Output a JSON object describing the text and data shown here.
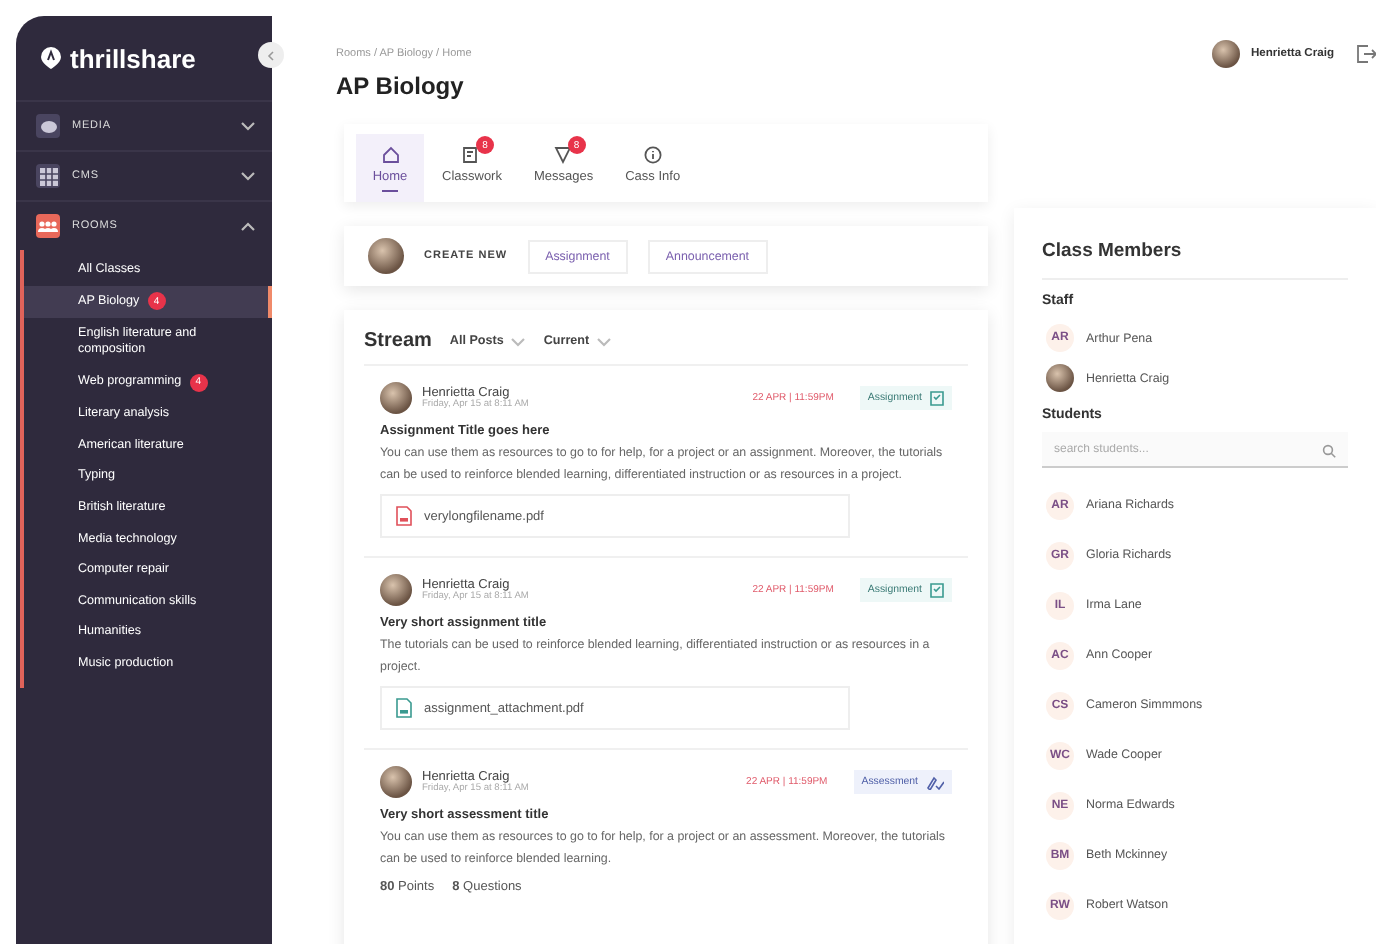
{
  "sidebar": {
    "logo": "thrillshare",
    "sections": [
      {
        "label": "MEDIA",
        "kind": "media",
        "expanded": false
      },
      {
        "label": "CMS",
        "kind": "cms",
        "expanded": false
      },
      {
        "label": "ROOMS",
        "kind": "rooms",
        "expanded": true,
        "items": [
          {
            "label": "All Classes",
            "selected": false
          },
          {
            "label": "AP Biology",
            "selected": true,
            "badge": "4"
          },
          {
            "label": "English literature and composition",
            "selected": false
          },
          {
            "label": "Web programming",
            "selected": false,
            "badge": "4"
          },
          {
            "label": "Literary analysis",
            "selected": false
          },
          {
            "label": "American literature",
            "selected": false
          },
          {
            "label": "Typing",
            "selected": false
          },
          {
            "label": "British literature",
            "selected": false
          },
          {
            "label": "Media technology",
            "selected": false
          },
          {
            "label": "Computer repair",
            "selected": false
          },
          {
            "label": "Communication skills",
            "selected": false
          },
          {
            "label": "Humanities",
            "selected": false
          },
          {
            "label": "Music production",
            "selected": false
          }
        ]
      }
    ]
  },
  "breadcrumb": "Rooms / AP Biology / Home",
  "user": {
    "name": "Henrietta Craig"
  },
  "title": "AP Biology",
  "tabs": [
    {
      "label": "Home",
      "kind": "home",
      "selected": true
    },
    {
      "label": "Classwork",
      "kind": "classwork",
      "selected": false,
      "badge": "8"
    },
    {
      "label": "Messages",
      "kind": "messages",
      "selected": false,
      "badge": "8"
    },
    {
      "label": "Cass Info",
      "kind": "info",
      "selected": false
    }
  ],
  "create_new": {
    "label": "CREATE NEW",
    "buttons": [
      "Assignment",
      "Announcement"
    ]
  },
  "stream": {
    "title": "Stream",
    "filters": [
      "All Posts",
      "Current"
    ],
    "posts": [
      {
        "author": "Henrietta Craig",
        "date": "Friday, Apr 15 at 8:11 AM",
        "due": "22 APR | 11:59PM",
        "tag": "Assignment",
        "kind": "assignment",
        "title": "Assignment Title goes here",
        "body": "You can use them as resources to go to for help, for a project or an assignment. Moreover, the tutorials can be used to reinforce blended learning, differentiated instruction or as resources in a project.",
        "attachment": {
          "name": "verylongfilename.pdf",
          "kind": "pdf"
        }
      },
      {
        "author": "Henrietta Craig",
        "date": "Friday, Apr 15 at 8:11 AM",
        "due": "22 APR | 11:59PM",
        "tag": "Assignment",
        "kind": "assignment",
        "title": "Very short assignment title",
        "body": "The tutorials can be used to reinforce blended learning, differentiated instruction or as resources in a project.",
        "attachment": {
          "name": "assignment_attachment.pdf",
          "kind": "doc"
        }
      },
      {
        "author": "Henrietta Craig",
        "date": "Friday, Apr 15 at 8:11 AM",
        "due": "22 APR | 11:59PM",
        "tag": "Assessment",
        "kind": "assessment",
        "title": "Very short assessment title",
        "body": "You can use them as resources to go to for help, for a project or an assessment. Moreover, the tutorials can be used to reinforce blended learning.",
        "stats": [
          "**80** Points",
          "**8** Questions"
        ]
      }
    ]
  },
  "members": {
    "title": "Class Members",
    "staff_label": "Staff",
    "staff": [
      {
        "kind": "initials",
        "initials": "AR",
        "name": "Arthur Pena"
      },
      {
        "kind": "photo",
        "name": "Henrietta Craig"
      }
    ],
    "students_label": "Students",
    "search": {
      "placeholder": "search students..."
    },
    "students": [
      {
        "initials": "AR",
        "name": "Ariana Richards"
      },
      {
        "initials": "GR",
        "name": "Gloria Richards"
      },
      {
        "initials": "IL",
        "name": "Irma Lane"
      },
      {
        "initials": "AC",
        "name": "Ann Cooper"
      },
      {
        "initials": "CS",
        "name": "Cameron Simmmons"
      },
      {
        "initials": "WC",
        "name": "Wade Cooper"
      },
      {
        "initials": "NE",
        "name": "Norma Edwards"
      },
      {
        "initials": "BM",
        "name": "Beth Mckinney"
      },
      {
        "initials": "RW",
        "name": "Robert Watson"
      }
    ]
  }
}
